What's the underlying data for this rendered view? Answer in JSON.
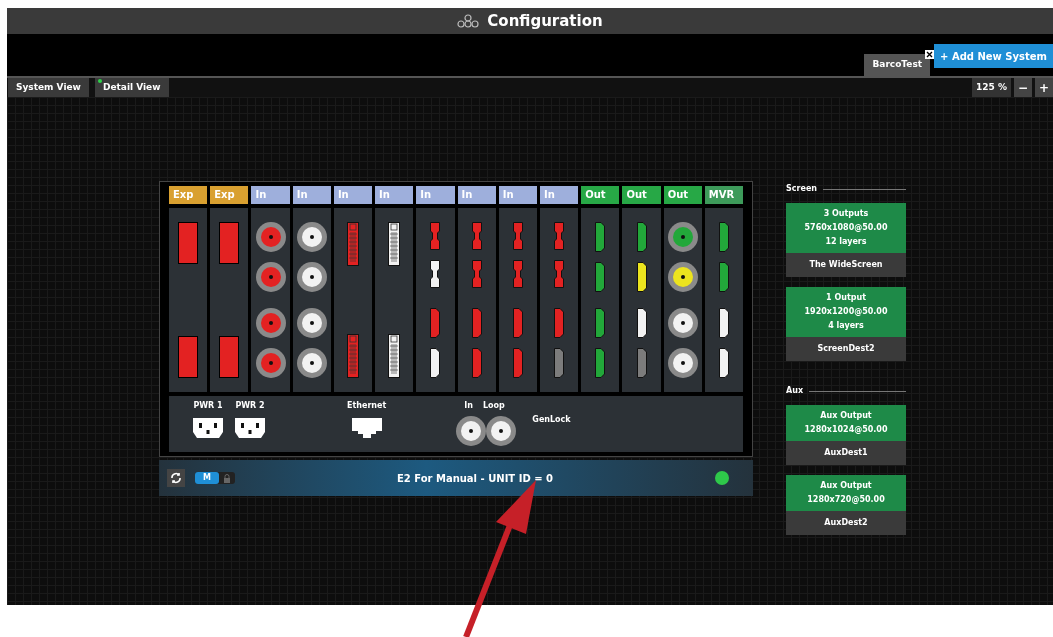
{
  "window": {
    "title": "Configuration"
  },
  "system_tabs": [
    {
      "label": "BarcoTest",
      "selected": true
    }
  ],
  "add_button": "+ Add New System",
  "view_tabs": [
    {
      "label": "System View",
      "selected": false
    },
    {
      "label": "Detail View",
      "selected": true
    }
  ],
  "zoom": {
    "value": "125 %",
    "minus": "−",
    "plus": "+"
  },
  "slots": [
    {
      "label": "Exp",
      "kind": "exp",
      "ports": [
        {
          "kind": "exp",
          "color": "#e32222"
        },
        {
          "kind": "exp",
          "color": "#e32222"
        }
      ]
    },
    {
      "label": "Exp",
      "kind": "exp",
      "ports": [
        {
          "kind": "exp",
          "color": "#e32222"
        },
        {
          "kind": "exp",
          "color": "#e32222"
        }
      ]
    },
    {
      "label": "In",
      "kind": "in",
      "ports": [
        {
          "kind": "bnc",
          "color": "#e32222"
        },
        {
          "kind": "bnc",
          "color": "#e32222"
        },
        {
          "kind": "bnc",
          "color": "#e32222"
        },
        {
          "kind": "bnc",
          "color": "#e32222"
        }
      ]
    },
    {
      "label": "In",
      "kind": "in",
      "ports": [
        {
          "kind": "bnc",
          "color": "#f2f2f2"
        },
        {
          "kind": "bnc",
          "color": "#f2f2f2"
        },
        {
          "kind": "bnc",
          "color": "#f2f2f2"
        },
        {
          "kind": "bnc",
          "color": "#f2f2f2"
        }
      ]
    },
    {
      "label": "In",
      "kind": "in",
      "ports": [
        {
          "kind": "dvi",
          "color": "#e32222"
        },
        {
          "kind": "dvi",
          "color": "#e32222"
        }
      ]
    },
    {
      "label": "In",
      "kind": "in",
      "ports": [
        {
          "kind": "dvi",
          "color": "#f2f2f2"
        },
        {
          "kind": "dvi",
          "color": "#f2f2f2"
        }
      ]
    },
    {
      "label": "In",
      "kind": "in",
      "ports": [
        {
          "kind": "dp",
          "color": "#e32222"
        },
        {
          "kind": "dp",
          "color": "#f2f2f2"
        },
        {
          "kind": "hdmi",
          "color": "#e32222"
        },
        {
          "kind": "hdmi",
          "color": "#f2f2f2"
        }
      ]
    },
    {
      "label": "In",
      "kind": "in",
      "ports": [
        {
          "kind": "dp",
          "color": "#e32222"
        },
        {
          "kind": "dp",
          "color": "#e32222"
        },
        {
          "kind": "hdmi",
          "color": "#e32222"
        },
        {
          "kind": "hdmi",
          "color": "#e32222"
        }
      ]
    },
    {
      "label": "In",
      "kind": "in",
      "ports": [
        {
          "kind": "dp",
          "color": "#e32222"
        },
        {
          "kind": "dp",
          "color": "#e32222"
        },
        {
          "kind": "hdmi",
          "color": "#e32222"
        },
        {
          "kind": "hdmi",
          "color": "#e32222"
        }
      ]
    },
    {
      "label": "In",
      "kind": "in",
      "ports": [
        {
          "kind": "dp",
          "color": "#e32222"
        },
        {
          "kind": "dp",
          "color": "#e32222"
        },
        {
          "kind": "hdmi",
          "color": "#e32222"
        },
        {
          "kind": "hdmi",
          "color": "#7c7c7c"
        }
      ]
    },
    {
      "label": "Out",
      "kind": "out",
      "ports": [
        {
          "kind": "hdmi",
          "color": "#22a83a"
        },
        {
          "kind": "hdmi",
          "color": "#22a83a"
        },
        {
          "kind": "hdmi",
          "color": "#22a83a"
        },
        {
          "kind": "hdmi",
          "color": "#22a83a"
        }
      ]
    },
    {
      "label": "Out",
      "kind": "out",
      "ports": [
        {
          "kind": "hdmi",
          "color": "#22a83a"
        },
        {
          "kind": "hdmi",
          "color": "#ece41e"
        },
        {
          "kind": "hdmi",
          "color": "#f2f2f2"
        },
        {
          "kind": "hdmi",
          "color": "#7c7c7c"
        }
      ]
    },
    {
      "label": "Out",
      "kind": "out",
      "ports": [
        {
          "kind": "bnc",
          "color": "#22a83a"
        },
        {
          "kind": "bnc",
          "color": "#ece41e"
        },
        {
          "kind": "bnc",
          "color": "#f2f2f2"
        },
        {
          "kind": "bnc",
          "color": "#f2f2f2"
        }
      ]
    },
    {
      "label": "MVR",
      "kind": "mvr",
      "ports": [
        {
          "kind": "hdmi",
          "color": "#22a83a"
        },
        {
          "kind": "hdmi",
          "color": "#22a83a"
        },
        {
          "kind": "hdmi",
          "color": "#f2f2f2"
        },
        {
          "kind": "hdmi",
          "color": "#f2f2f2"
        }
      ]
    }
  ],
  "rear_panel": {
    "power": [
      "PWR 1",
      "PWR 2"
    ],
    "ethernet": "Ethernet",
    "genlock_in": "In",
    "genlock_loop": "Loop",
    "genlock": "GenLock"
  },
  "status_bar": {
    "mode": "M",
    "title": "E2 For Manual - UNIT ID = 0"
  },
  "destinations": [
    {
      "heading": "Screen",
      "items": [
        {
          "lines": [
            "3 Outputs",
            "5760x1080@50.00",
            "12 layers"
          ],
          "name": "The WideScreen"
        },
        {
          "lines": [
            "1 Output",
            "1920x1200@50.00",
            "4 layers"
          ],
          "name": "ScreenDest2"
        }
      ]
    },
    {
      "heading": "Aux",
      "items": [
        {
          "lines": [
            "Aux Output",
            "1280x1024@50.00"
          ],
          "name": "AuxDest1"
        },
        {
          "lines": [
            "Aux Output",
            "1280x720@50.00"
          ],
          "name": "AuxDest2"
        }
      ]
    }
  ]
}
